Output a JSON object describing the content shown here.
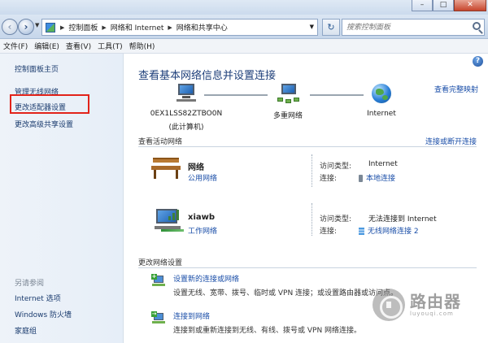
{
  "window": {
    "min_label": "–",
    "max_label": "□",
    "close_label": "✕"
  },
  "address": {
    "crumbs": [
      "控制面板",
      "网络和 Internet",
      "网络和共享中心"
    ],
    "search_placeholder": "搜索控制面板"
  },
  "menu": [
    "文件(F)",
    "编辑(E)",
    "查看(V)",
    "工具(T)",
    "帮助(H)"
  ],
  "sidebar": {
    "links": [
      "控制面板主页",
      "管理无线网络",
      "更改适配器设置",
      "更改高级共享设置"
    ],
    "see_also_title": "另请参阅",
    "see_also": [
      "Internet 选项",
      "Windows 防火墙",
      "家庭组"
    ]
  },
  "main": {
    "title": "查看基本网络信息并设置连接",
    "full_map_link": "查看完整映射",
    "map": {
      "computer_name": "0EX1LSS82ZTBO0N",
      "computer_sub": "(此计算机)",
      "middle_label": "多重网络",
      "internet_label": "Internet"
    },
    "active_header": "查看活动网络",
    "connect_link": "连接或断开连接",
    "networks": [
      {
        "name": "网络",
        "type": "公用网络",
        "access_label": "访问类型:",
        "access_value": "Internet",
        "conn_label": "连接:",
        "conn_value": "本地连接"
      },
      {
        "name": "xiawb",
        "type": "工作网络",
        "access_label": "访问类型:",
        "access_value": "无法连接到 Internet",
        "conn_label": "连接:",
        "conn_value": "无线网络连接 2"
      }
    ],
    "change_header": "更改网络设置",
    "tasks": [
      {
        "link": "设置新的连接或网络",
        "desc": "设置无线、宽带、拨号、临时或 VPN 连接；或设置路由器或访问点。"
      },
      {
        "link": "连接到网络",
        "desc": "连接到或重新连接到无线、有线、拨号或 VPN 网络连接。"
      }
    ]
  },
  "watermark": {
    "text": "路由器",
    "sub": "luyouqi.com"
  },
  "colors": {
    "link": "#1a4ea8",
    "title": "#1e3f7a",
    "highlight": "#e2231a"
  }
}
